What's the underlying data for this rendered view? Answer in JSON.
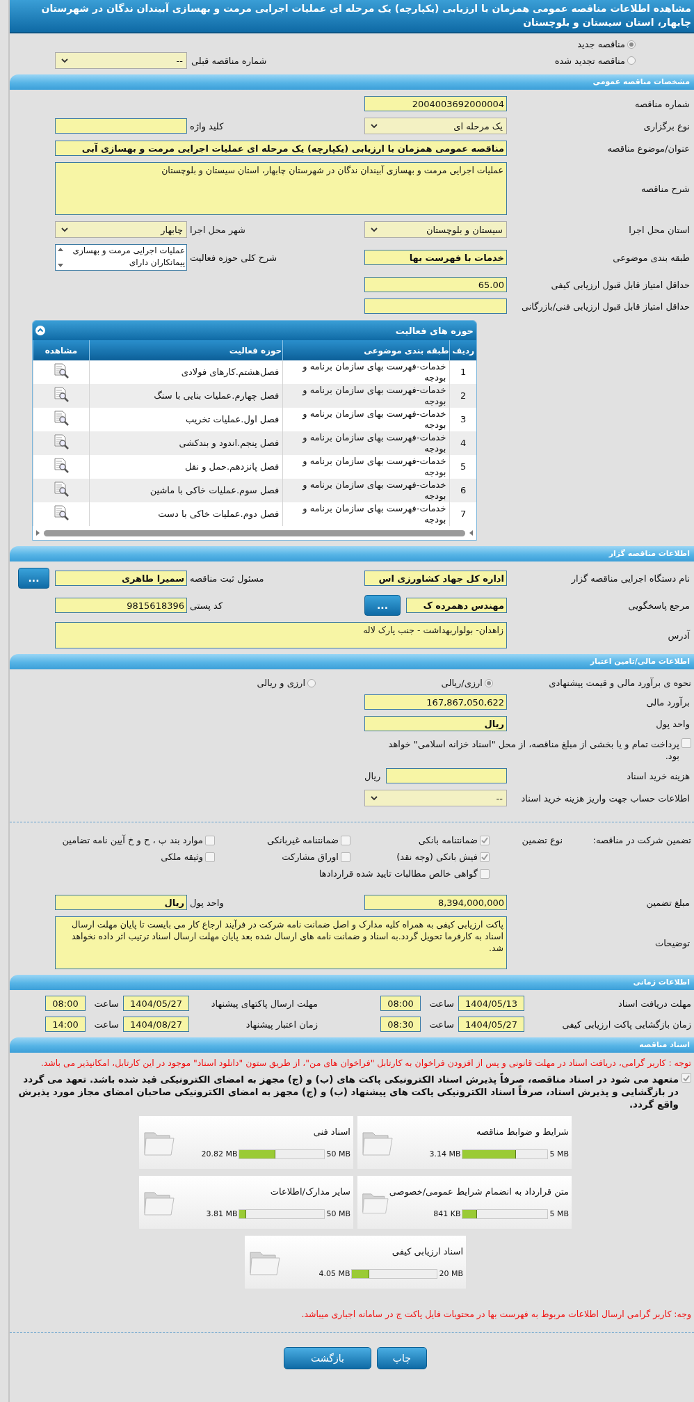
{
  "title": "مشاهده اطلاعات مناقصه عمومی همزمان با ارزیابی (یکپارچه) یک مرحله ای عملیات اجرایی مرمت و بهسازی آبیندان ندگان در شهرستان چابهار، استان سیستان و بلوچستان",
  "tender_type": {
    "radios": [
      {
        "label": "مناقصه جدید",
        "selected": true
      },
      {
        "label": "مناقصه تجدید شده",
        "selected": false
      }
    ],
    "previous": {
      "label": "شماره مناقصه قبلی",
      "value": "--",
      "kind": "select"
    }
  },
  "general": {
    "title": "مشخصات مناقصه عمومی",
    "rows": [
      {
        "cells": [
          {
            "label": "شماره مناقصه",
            "value": "2004003692000004",
            "kind": "input"
          }
        ]
      },
      {
        "cells": [
          {
            "label": "نوع برگزاری",
            "value": "یک مرحله ای",
            "kind": "select"
          },
          {
            "label": "کلید واژه",
            "kind": "input"
          }
        ]
      },
      {
        "cells": [
          {
            "label": "عنوان/موضوع مناقصه",
            "value": "مناقصه عمومی همزمان با ارزیابی (یکپارچه) یک مرحله ای عملیات اجرایی مرمت و بهسازی آبی",
            "kind": "wide-strong-input"
          }
        ]
      },
      {
        "cells": [
          {
            "label": "شرح مناقصه",
            "value": "عملیات اجرایی مرمت و بهسازی آبیندان ندگان در شهرستان چابهار، استان سیستان و بلوچستان",
            "kind": "large-textarea"
          }
        ]
      },
      {
        "cells": [
          {
            "label": "استان محل اجرا",
            "value": "سیستان و بلوچستان",
            "kind": "select"
          },
          {
            "label": "شهر محل اجرا",
            "value": "چابهار",
            "kind": "select"
          }
        ]
      },
      {
        "cells": [
          {
            "label": "طبقه بندی موضوعی",
            "value": "خدمات با فهرست بها",
            "kind": "strong-input"
          },
          {
            "label": "شرح کلی حوزه فعالیت",
            "value": "عملیات اجرایی مرمت و بهسازی پیمانکاران دارای",
            "kind": "scrollbox"
          }
        ]
      },
      {
        "cells": [
          {
            "label": "حداقل امتیاز قابل قبول ارزیابی کیفی",
            "value": "65.00",
            "kind": "input"
          }
        ]
      },
      {
        "cells": [
          {
            "label": "حداقل امتیاز قابل قبول ارزیابی فنی/بازرگانی",
            "kind": "input"
          }
        ]
      }
    ]
  },
  "activities": {
    "title": "حوزه های فعالیت",
    "columns": [
      "ردیف",
      "طبقه بندی موضوعی",
      "حوزه فعالیت",
      "مشاهده"
    ],
    "rows": [
      {
        "index": "1",
        "category": "خدمات-فهرست بهای سازمان برنامه و بودجه",
        "activity": "فصل‌هشتم.کارهای فولادی"
      },
      {
        "index": "2",
        "category": "خدمات-فهرست بهای سازمان برنامه و بودجه",
        "activity": "فصل چهارم.عملیات بنایی با سنگ"
      },
      {
        "index": "3",
        "category": "خدمات-فهرست بهای سازمان برنامه و بودجه",
        "activity": "فصل اول.عملیات تخریب"
      },
      {
        "index": "4",
        "category": "خدمات-فهرست بهای سازمان برنامه و بودجه",
        "activity": "فصل پنجم.اندود و بندکشی"
      },
      {
        "index": "5",
        "category": "خدمات-فهرست بهای سازمان برنامه و بودجه",
        "activity": "فصل پانزدهم.حمل و نقل"
      },
      {
        "index": "6",
        "category": "خدمات-فهرست بهای سازمان برنامه و بودجه",
        "activity": "فصل سوم.عملیات خاکی با ماشین"
      },
      {
        "index": "7",
        "category": "خدمات-فهرست بهای سازمان برنامه و بودجه",
        "activity": "فصل دوم.عملیات خاکی با دست"
      }
    ]
  },
  "tenderer": {
    "title": "اطلاعات مناقصه گزار",
    "rows": [
      {
        "cells": [
          {
            "label": "نام دستگاه اجرایی مناقصه گزار",
            "value": "اداره کل جهاد کشاورزی اس",
            "kind": "strong-input"
          },
          {
            "label": "مسئول ثبت مناقصه",
            "value": "سمیرا طاهری",
            "kind": "strong-input",
            "button": "..."
          }
        ]
      },
      {
        "cells": [
          {
            "label": "مرجع پاسخگویی",
            "value": "مهندس دهمرده ک",
            "kind": "strong-input",
            "button": "..."
          },
          {
            "label": "کد پستی",
            "value": "9815618396",
            "kind": "input"
          }
        ]
      },
      {
        "cells": [
          {
            "label": "آدرس",
            "value": "زاهدان- بولواربهداشت - جنب پارک لاله",
            "kind": "textarea"
          }
        ]
      }
    ]
  },
  "finance": {
    "title": "اطلاعات مالی/تامین اعتبار",
    "estimate": {
      "label": "نحوه ی برآورد مالی و قیمت پیشنهادی",
      "options": [
        {
          "label": "ارزی/ریالی",
          "selected": true
        },
        {
          "label": "ارزی و ریالی",
          "selected": false
        }
      ]
    },
    "rows": [
      {
        "cells": [
          {
            "label": "برآورد مالی",
            "value": "167,867,050,622",
            "kind": "input"
          }
        ]
      },
      {
        "cells": [
          {
            "label": "واحد پول",
            "value": "ریال",
            "kind": "strong-input"
          }
        ]
      }
    ],
    "treasury": {
      "label": "پرداخت تمام و یا بخشی از مبلغ مناقصه، از محل \"اسناد خزانه اسلامی\" خواهد بود.",
      "checked": false
    },
    "rows2": [
      {
        "cells": [
          {
            "label": "هزینه خرید اسناد",
            "kind": "input",
            "suffix": "ریال"
          }
        ]
      },
      {
        "cells": [
          {
            "label": "اطلاعات حساب جهت واریز هزینه خرید اسناد",
            "value": "--",
            "kind": "select"
          }
        ]
      }
    ]
  },
  "guarantee": {
    "label": "تضمین شرکت در مناقصه:",
    "type_label": "نوع تضمین",
    "options": [
      {
        "label": "ضمانتنامه بانکی",
        "checked": true
      },
      {
        "label": "ضمانتنامه غیربانکی",
        "checked": false
      },
      {
        "label": "موارد بند پ ، ح و خ آیین نامه تضامین",
        "checked": false
      },
      {
        "label": "فیش بانکی (وجه نقد)",
        "checked": true
      },
      {
        "label": "اوراق مشارکت",
        "checked": false
      },
      {
        "label": "وثیقه ملکی",
        "checked": false
      },
      {
        "label": "گواهی خالص مطالبات تایید شده قراردادها",
        "checked": false
      }
    ],
    "rows": [
      {
        "cells": [
          {
            "label": "مبلغ تضمین",
            "value": "8,394,000,000",
            "kind": "input"
          },
          {
            "label": "واحد پول",
            "value": "ریال",
            "kind": "strong-input"
          }
        ]
      },
      {
        "cells": [
          {
            "label": "توضیحات",
            "value": "پاکت ارزیابی کیفی به همراه کلیه مدارک و اصل ضمانت نامه شرکت در فرآیند ارجاع کار می بایست تا پایان مهلت ارسال اسناد به کارفرما تحویل گردد.به اسناد و ضمانت نامه های ارسال شده بعد پایان مهلت ارسال اسناد ترتیب اثر داده نخواهد شد.",
            "kind": "large-textarea"
          }
        ]
      }
    ]
  },
  "timing": {
    "title": "اطلاعات زمانی",
    "rows": [
      {
        "items": [
          {
            "label": "مهلت دریافت اسناد",
            "date": "1404/05/13",
            "time_label": "ساعت",
            "time": "08:00"
          },
          {
            "label": "مهلت ارسال پاکتهای پیشنهاد",
            "date": "1404/05/27",
            "time_label": "ساعت",
            "time": "08:00"
          }
        ]
      },
      {
        "items": [
          {
            "label": "زمان بازگشایی پاکت ارزیابی کیفی",
            "date": "1404/05/27",
            "time_label": "ساعت",
            "time": "08:30"
          },
          {
            "label": "زمان اعتبار پیشنهاد",
            "date": "1404/08/27",
            "time_label": "ساعت",
            "time": "14:00"
          }
        ]
      }
    ]
  },
  "documents": {
    "title": "اسناد مناقصه",
    "notice": "توجه : کاربر گرامی، دریافت اسناد در مهلت قانونی و پس از افزودن فراخوان به کارتابل \"فراخوان های من\"، از طریق ستون \"دانلود اسناد\" موجود در این کارتابل، امکانپذیر می باشد.",
    "commitment": {
      "text": "متعهد می شود در اسناد مناقصه، صرفاً پذیرش اسناد الکترونیکی پاکت های (ب) و (ج) مجهز به امضای الکترونیکی قید شده باشد. تعهد می گردد در بازگشایی و پذیرش اسناد، صرفاً اسناد الکترونیکی پاکت های پیشنهاد (ب) و (ج) مجهز به امضای الکترونیکی صاحبان امضای مجاز مورد پذیرش واقع گردد.",
      "checked": true
    },
    "files": [
      {
        "name": "شرایط و ضوابط مناقصه",
        "size": "3.14 MB",
        "max": "5 MB",
        "level": 0.63
      },
      {
        "name": "اسناد فنی",
        "size": "20.82 MB",
        "max": "50 MB",
        "level": 0.42
      },
      {
        "name": "متن قرارداد به انضمام شرایط عمومی/خصوصی",
        "size": "841 KB",
        "max": "5 MB",
        "level": 0.17
      },
      {
        "name": "سایر مدارک/اطلاعات",
        "size": "3.81 MB",
        "max": "50 MB",
        "level": 0.08
      },
      {
        "name": "اسناد ارزیابی کیفی",
        "size": "4.05 MB",
        "max": "20 MB",
        "level": 0.2
      }
    ],
    "footer_note": "وجه: کاربر گرامی ارسال اطلاعات مربوط به فهرست بها در محتویات فایل پاکت ج در سامانه اجباری میباشد."
  },
  "buttons": [
    {
      "label": "چاپ"
    },
    {
      "label": "بازگشت"
    }
  ]
}
